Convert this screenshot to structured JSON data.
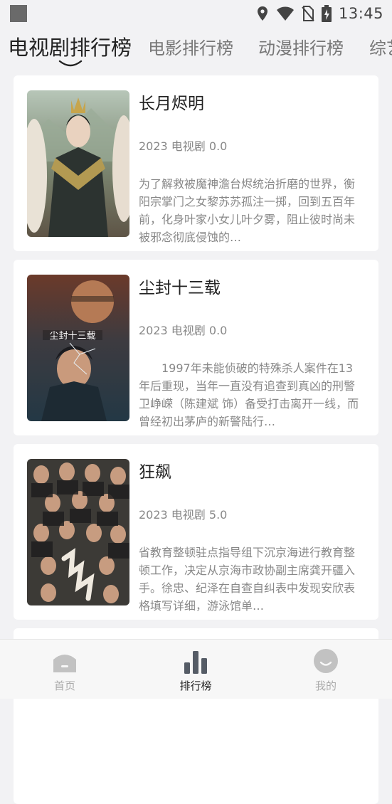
{
  "status_bar": {
    "time": "13:45"
  },
  "tabs": [
    {
      "label": "电视剧排行榜",
      "active": true
    },
    {
      "label": "电影排行榜",
      "active": false
    },
    {
      "label": "动漫排行榜",
      "active": false
    },
    {
      "label": "综艺",
      "active": false
    }
  ],
  "items": [
    {
      "title": "长月烬明",
      "meta": "2023 电视剧 0.0",
      "description": "为了解救被魔神澹台烬统治折磨的世界，衡阳宗掌门之女黎苏苏孤注一掷，回到五百年前，化身叶家小女儿叶夕雾，阻止彼时尚未被邪念彻底侵蚀的…"
    },
    {
      "title": "尘封十三载",
      "meta": "2023 电视剧 0.0",
      "description": "　　1997年未能侦破的特殊杀人案件在13年后重现，当年一直没有追查到真凶的刑警卫峥嵘（陈建斌 饰）备受打击离开一线，而曾经初出茅庐的新警陆行…"
    },
    {
      "title": "狂飙",
      "meta": "2023 电视剧 5.0",
      "description": "省教育整顿驻点指导组下沉京海进行教育整顿工作，决定从京海市政协副主席龚开疆入手。徐忠、纪泽在自查自纠表中发现安欣表格填写详细，游泳馆单…"
    }
  ],
  "bottom_nav": [
    {
      "label": "首页",
      "icon": "home-icon",
      "active": false
    },
    {
      "label": "排行榜",
      "icon": "ranking-icon",
      "active": true
    },
    {
      "label": "我的",
      "icon": "profile-icon",
      "active": false
    }
  ],
  "colors": {
    "background": "#f2f2f4",
    "card": "#ffffff",
    "active_text": "#222222",
    "inactive_text": "#aaaaaa"
  }
}
